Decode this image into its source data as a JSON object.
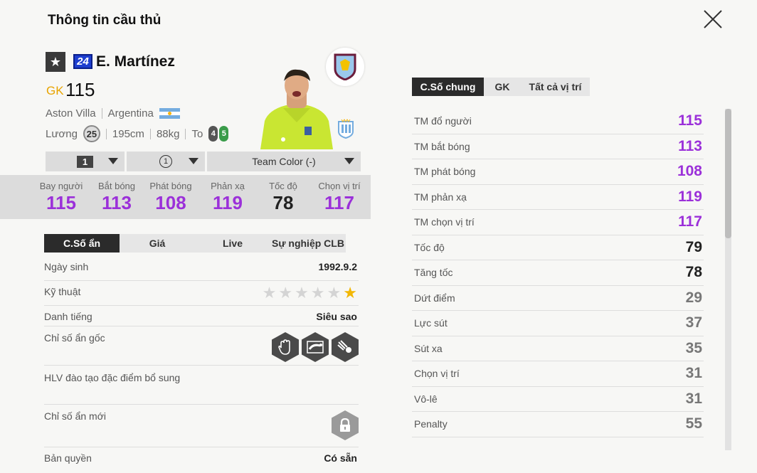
{
  "header": {
    "title": "Thông tin cầu thủ"
  },
  "player": {
    "season_number": "24",
    "name": "E. Martínez",
    "position": "GK",
    "ovr": "115",
    "club": "Aston Villa",
    "nation": "Argentina",
    "salary_label": "Lương",
    "salary": "25",
    "height": "195cm",
    "weight": "88kg",
    "body_type": "To",
    "weak_foot_left": "4",
    "weak_foot_right": "5"
  },
  "selectors": {
    "upgrade_level": "1",
    "team_color_rank": "1",
    "team_color": "Team Color (-)"
  },
  "key_stats": [
    {
      "label": "Bay người",
      "value": "115",
      "color": "#9b30d9"
    },
    {
      "label": "Bắt bóng",
      "value": "113",
      "color": "#9b30d9"
    },
    {
      "label": "Phát bóng",
      "value": "108",
      "color": "#9b30d9"
    },
    {
      "label": "Phản xạ",
      "value": "119",
      "color": "#9b30d9"
    },
    {
      "label": "Tốc độ",
      "value": "78",
      "color": "#222222"
    },
    {
      "label": "Chọn vị trí",
      "value": "117",
      "color": "#9b30d9"
    }
  ],
  "left_tabs": [
    "C.Số ẩn",
    "Giá",
    "Live",
    "Sự nghiệp CLB"
  ],
  "details": {
    "birth_label": "Ngày sinh",
    "birth": "1992.9.2",
    "skill_label": "Kỹ thuật",
    "skill_stars": 1,
    "skill_max": 6,
    "fame_label": "Danh tiếng",
    "fame": "Siêu sao",
    "traits_label": "Chỉ số ẩn gốc",
    "traits_icons": [
      "glove-icon",
      "diving-keeper-icon",
      "punch-icon"
    ],
    "coach_label": "HLV đào tạo đặc điểm bổ sung",
    "new_traits_label": "Chỉ số ẩn mới",
    "license_label": "Bản quyền",
    "license": "Có sẵn"
  },
  "right_tabs": [
    "C.Số chung",
    "GK",
    "Tất cả vị trí"
  ],
  "attributes": [
    {
      "name": "TM đổ người",
      "value": "115",
      "color": "#9b30d9"
    },
    {
      "name": "TM bắt bóng",
      "value": "113",
      "color": "#9b30d9"
    },
    {
      "name": "TM phát bóng",
      "value": "108",
      "color": "#9b30d9"
    },
    {
      "name": "TM phản xạ",
      "value": "119",
      "color": "#9b30d9"
    },
    {
      "name": "TM chọn vị trí",
      "value": "117",
      "color": "#9b30d9"
    },
    {
      "name": "Tốc độ",
      "value": "79",
      "color": "#222222"
    },
    {
      "name": "Tăng tốc",
      "value": "78",
      "color": "#222222"
    },
    {
      "name": "Dứt điểm",
      "value": "29",
      "color": "#777777"
    },
    {
      "name": "Lực sút",
      "value": "37",
      "color": "#777777"
    },
    {
      "name": "Sút xa",
      "value": "35",
      "color": "#777777"
    },
    {
      "name": "Chọn vị trí",
      "value": "31",
      "color": "#777777"
    },
    {
      "name": "Vô-lê",
      "value": "31",
      "color": "#777777"
    },
    {
      "name": "Penalty",
      "value": "55",
      "color": "#777777"
    }
  ],
  "colors": {
    "accent_gk": "#e8a400",
    "high_stat": "#9b30d9",
    "tab_active": "#2b2b2b"
  }
}
